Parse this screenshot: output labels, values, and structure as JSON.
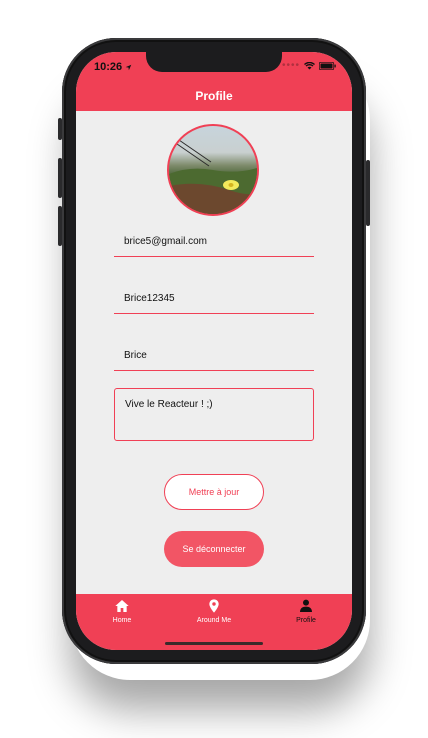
{
  "status": {
    "time": "10:26"
  },
  "header": {
    "title": "Profile"
  },
  "form": {
    "email": "brice5@gmail.com",
    "username": "Brice12345",
    "name": "Brice",
    "description": "Vive le Reacteur ! ;)"
  },
  "buttons": {
    "update": "Mettre à jour",
    "logout": "Se déconnecter"
  },
  "tabs": [
    {
      "label": "Home",
      "icon": "home-icon"
    },
    {
      "label": "Around Me",
      "icon": "map-pin-icon"
    },
    {
      "label": "Profile",
      "icon": "user-icon",
      "active": true
    }
  ],
  "colors": {
    "accent": "#f04055",
    "button_filled": "#f25565",
    "background": "#eeeeee"
  }
}
